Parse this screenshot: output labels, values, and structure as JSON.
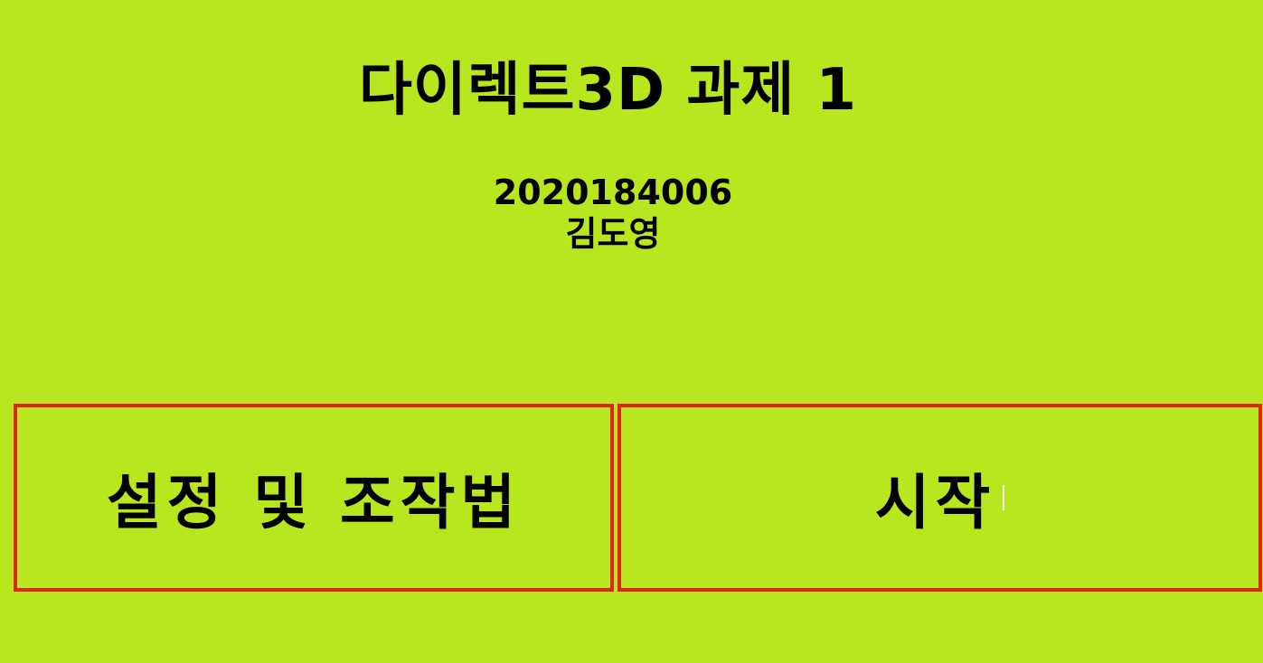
{
  "title": "다이렉트3D 과제 1",
  "student": {
    "id": "2020184006",
    "name": "김도영"
  },
  "buttons": {
    "settings_label": "설정 및 조작법",
    "start_label": "시작"
  },
  "colors": {
    "background": "#b8e61f",
    "button_border": "#e2231a",
    "text": "#000000"
  }
}
